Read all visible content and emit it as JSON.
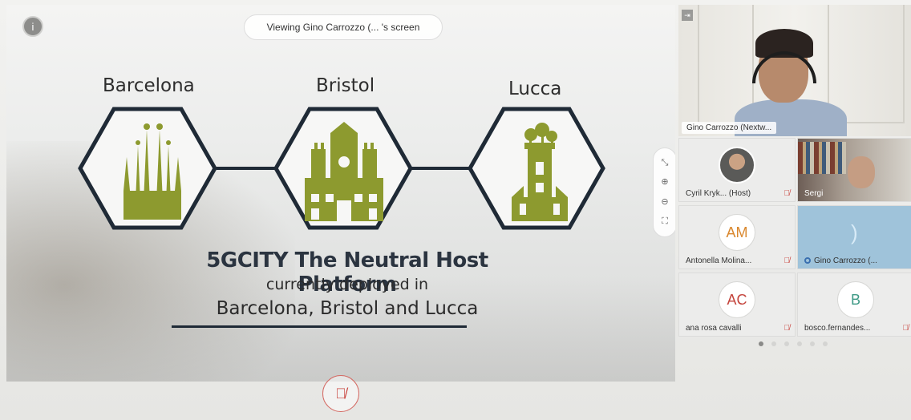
{
  "share": {
    "viewing_text": "Viewing Gino Carrozzo (...  's screen",
    "info_glyph": "i"
  },
  "slide": {
    "cities": [
      "Barcelona",
      "Bristol",
      "Lucca"
    ],
    "title": "5GCITY The Neutral Host Platform",
    "subtitle": "currently deployed in",
    "cities_line": "Barcelona, Bristol and Lucca",
    "accent_color": "#8d9a2f",
    "line_color": "#1f2a36"
  },
  "zoom": {
    "icons": [
      "collapse-icon",
      "zoom-in-icon",
      "zoom-out-icon",
      "fullscreen-icon"
    ],
    "glyphs": [
      "⤡",
      "⊕",
      "⊖",
      "⛶"
    ]
  },
  "speaker": {
    "name": "Gino Carrozzo (Nextw..."
  },
  "participants": [
    {
      "name": "Cyril Kryk...  (Host)",
      "type": "photo",
      "muted": true
    },
    {
      "name": "Sergi",
      "type": "video",
      "muted": false
    },
    {
      "name": "Antonella Molina...",
      "type": "initials",
      "initials": "AM",
      "initials_color": "#d9872d",
      "muted": true
    },
    {
      "name": "Gino Carrozzo (...",
      "type": "talking",
      "muted": false
    },
    {
      "name": "ana rosa cavalli",
      "type": "initials",
      "initials": "AC",
      "initials_color": "#c4443c",
      "muted": true
    },
    {
      "name": "bosco.fernandes...",
      "type": "initials",
      "initials": "B",
      "initials_color": "#3f9a86",
      "muted": true
    }
  ],
  "mute_glyph": "🎙",
  "pager": {
    "count": 6,
    "active": 0
  }
}
